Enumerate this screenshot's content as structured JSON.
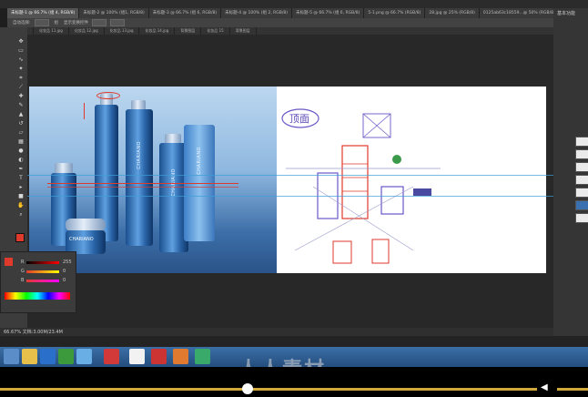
{
  "app": {
    "tabs": [
      {
        "label": "未标题-1 @ 66.7% (组 4, RGB/8)"
      },
      {
        "label": "未标题-2 @ 100% (组1, RGB/8)"
      },
      {
        "label": "未标题-3 @ 66.7% (组 6, RGB/8)"
      },
      {
        "label": "未标题-4 @ 100% (组 2, RGB/8)"
      },
      {
        "label": "未标题-5 @ 66.7% (组 6, RGB/8)"
      },
      {
        "label": "5-1.png @ 66.7% (RGB/8)"
      },
      {
        "label": "28.jpg @ 25% (RGB/8)"
      },
      {
        "label": "0125ab63c18559...@ 50% (RGB/8)"
      }
    ],
    "doc_tabs": [
      "背景图层",
      "化妆品 11.jpg",
      "化妆品 12.jpg",
      "化妆品 13.jpg",
      "化妆品 14.jpg",
      "背景图层",
      "化妆品 15",
      "背景图层"
    ],
    "options": [
      "自动选择:",
      "组",
      "显示变换控件"
    ],
    "right_panel_title": "基本功能",
    "status_text": "66.67%  文档:3.00M/23.4M",
    "tool_icons": [
      "move-icon",
      "marquee-icon",
      "lasso-icon",
      "magic-wand-icon",
      "crop-icon",
      "eyedropper-icon",
      "healing-icon",
      "brush-icon",
      "stamp-icon",
      "history-brush-icon",
      "eraser-icon",
      "gradient-icon",
      "blur-icon",
      "dodge-icon",
      "pen-icon",
      "type-icon",
      "path-select-icon",
      "shape-icon",
      "hand-icon",
      "zoom-icon"
    ],
    "colors": {
      "accent": "#cfa93a",
      "taskbar": "#2c5a90",
      "foreground": "#e03a2c",
      "background": "#ffffff"
    }
  },
  "canvas": {
    "product_brand": "CHARIANO",
    "bottles": [
      "Hydra-Balance Moisturizer",
      "Pure Double Skin Refiner",
      "Pure Triple Serum",
      "Pure Clear Mask Off"
    ],
    "sketch_label": "顶面"
  },
  "color_panel": {
    "labels": [
      "R",
      "G",
      "B"
    ],
    "values": [
      "255",
      "0",
      "0"
    ]
  },
  "video": {
    "progress": 0.45,
    "watermark": "人人素材"
  }
}
